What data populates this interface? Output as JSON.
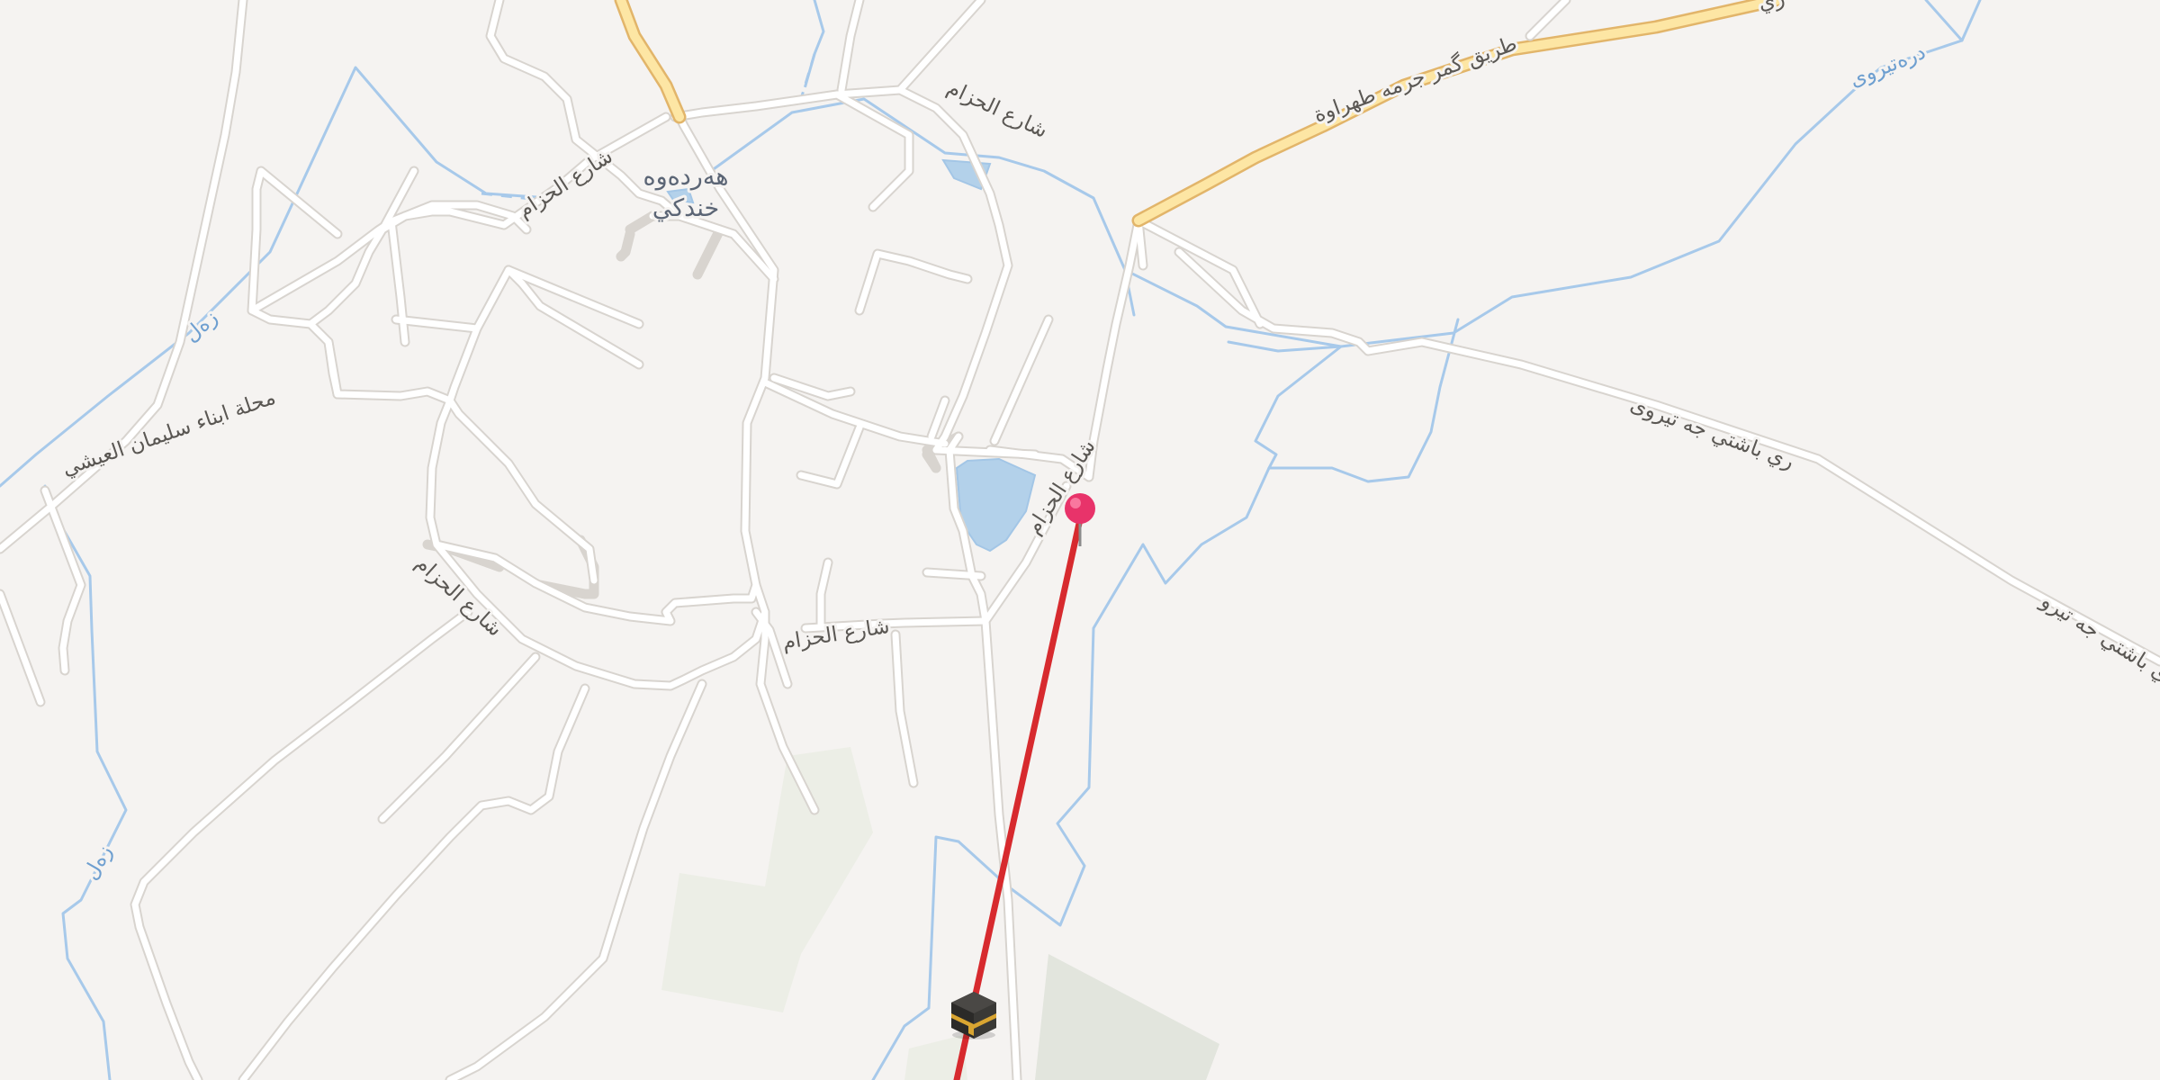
{
  "map": {
    "place_label": {
      "line1": "هه‌رده‌وه",
      "line2": "خندكي"
    },
    "road_labels": [
      "شارع الحزام",
      "شارع الحزام",
      "شارع الحزام",
      "شارع الحزام",
      "شارع الحزام",
      "محلة ابناء سليمان العيشي",
      "ري باشتي جه تيروى",
      "ري باشتي جه تيرو",
      "طريق گمر جرمه طهراوة",
      "ري"
    ],
    "water_labels": [
      "زه‌ل",
      "زه‌ل",
      "دره‌تيروى"
    ],
    "route_color": "#d72a2e",
    "marker": {
      "name": "pin-icon",
      "color": "#e8336a"
    },
    "poi": {
      "name": "kaaba-icon"
    }
  }
}
